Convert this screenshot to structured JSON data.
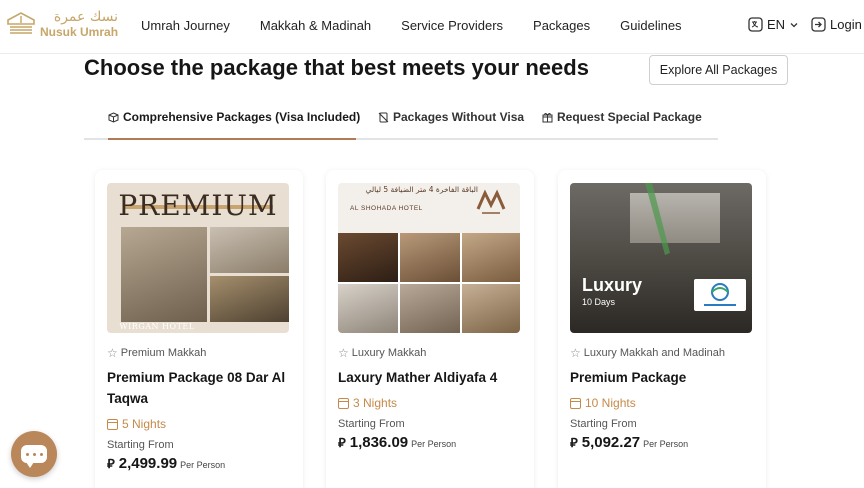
{
  "header": {
    "logo_ar": "نسك عمرة",
    "logo_en": "Nusuk Umrah",
    "nav": [
      "Umrah Journey",
      "Makkah & Madinah",
      "Service Providers",
      "Packages",
      "Guidelines"
    ],
    "lang": "EN",
    "login": "Login"
  },
  "section": {
    "title": "Choose the package that best meets your needs",
    "explore": "Explore All Packages"
  },
  "tabs": [
    {
      "label": "Comprehensive Packages (Visa Included)",
      "active": true
    },
    {
      "label": "Packages Without Visa",
      "active": false
    },
    {
      "label": "Request Special Package",
      "active": false
    }
  ],
  "cards": [
    {
      "category": "Premium Makkah",
      "name": "Premium Package 08 Dar Al Taqwa",
      "nights": "5 Nights",
      "starting_from": "Starting From",
      "currency": "⃁",
      "price": "2,499.99",
      "per": "Per Person",
      "image": {
        "headline": "PREMIUM",
        "caption": "WIRGAN HOTEL"
      }
    },
    {
      "category": "Luxury Makkah",
      "name": "Laxury Mather Aldiyafa 4",
      "nights": "3 Nights",
      "starting_from": "Starting From",
      "currency": "⃁",
      "price": "1,836.09",
      "per": "Per Person",
      "image": {
        "headline": "الباقة الفاخرة 4 متر الضيافة 5 ليالي",
        "caption": "AL SHOHADA HOTEL"
      }
    },
    {
      "category": "Luxury Makkah and Madinah",
      "name": "Premium Package",
      "nights": "10 Nights",
      "starting_from": "Starting From",
      "currency": "⃁",
      "price": "5,092.27",
      "per": "Per Person",
      "image": {
        "headline": "Luxury",
        "caption": "10 Days"
      }
    }
  ],
  "colors": {
    "accent": "#b07b57",
    "gold": "#c7a66a",
    "nights": "#c58a4a",
    "chat": "#b9875a"
  }
}
